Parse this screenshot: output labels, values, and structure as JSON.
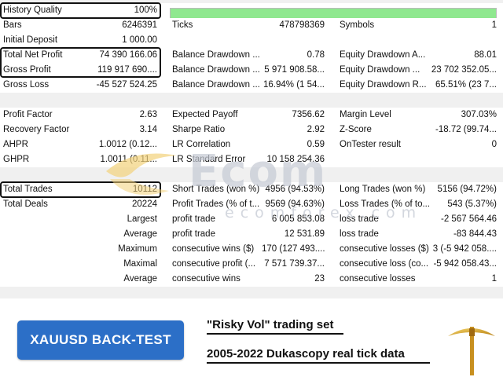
{
  "header": {
    "history_quality_label": "History Quality",
    "history_quality_value": "100%",
    "history_quality_fraction": 1.0
  },
  "rows": {
    "bars": {
      "l1": "Bars",
      "v1": "6246391",
      "l2": "Ticks",
      "v2": "478798369",
      "l3": "Symbols",
      "v3": "1"
    },
    "deposit": {
      "l1": "Initial Deposit",
      "v1": "1 000.00"
    },
    "net_profit": {
      "l1": "Total Net Profit",
      "v1": "74 390 166.06",
      "l2": "Balance Drawdown ...",
      "v2": "0.78",
      "l3": "Equity Drawdown A...",
      "v3": "88.01"
    },
    "gross_profit": {
      "l1": "Gross Profit",
      "v1": "119 917 690....",
      "l2": "Balance Drawdown ...",
      "v2": "5 971 908.58...",
      "l3": "Equity Drawdown ...",
      "v3": "23 702 352.05..."
    },
    "gross_loss": {
      "l1": "Gross Loss",
      "v1": "-45 527 524.25",
      "l2": "Balance Drawdown ...",
      "v2": "16.94% (1 54...",
      "l3": "Equity Drawdown R...",
      "v3": "65.51% (23 7..."
    },
    "profit_factor": {
      "l1": "Profit Factor",
      "v1": "2.63",
      "l2": "Expected Payoff",
      "v2": "7356.62",
      "l3": "Margin Level",
      "v3": "307.03%"
    },
    "recovery": {
      "l1": "Recovery Factor",
      "v1": "3.14",
      "l2": "Sharpe Ratio",
      "v2": "2.92",
      "l3": "Z-Score",
      "v3": "-18.72 (99.74..."
    },
    "ahpr": {
      "l1": "AHPR",
      "v1": "1.0012 (0.12...",
      "l2": "LR Correlation",
      "v2": "0.59",
      "l3": "OnTester result",
      "v3": "0"
    },
    "ghpr": {
      "l1": "GHPR",
      "v1": "1.0011 (0.11...",
      "l2": "LR Standard Error",
      "v2": "10 158 254.36"
    },
    "total_trades": {
      "l1": "Total Trades",
      "v1": "10112",
      "l2": "Short Trades (won %)",
      "v2": "4956 (94.53%)",
      "l3": "Long Trades (won %)",
      "v3": "5156 (94.72%)"
    },
    "total_deals": {
      "l1": "Total Deals",
      "v1": "20224",
      "l2": "Profit Trades (% of t...",
      "v2": "9569 (94.63%)",
      "l3": "Loss Trades (% of to...",
      "v3": "543 (5.37%)"
    },
    "largest": {
      "l1": "Largest",
      "l2": "profit trade",
      "v2": "6 005 853.08",
      "l3": "loss trade",
      "v3": "-2 567 564.46"
    },
    "average": {
      "l1": "Average",
      "l2": "profit trade",
      "v2": "12 531.89",
      "l3": "loss trade",
      "v3": "-83 844.43"
    },
    "maximum": {
      "l1": "Maximum",
      "l2": "consecutive wins ($)",
      "v2": "170 (127 493....",
      "l3": "consecutive losses ($)",
      "v3": "3 (-5 942 058...."
    },
    "maximal": {
      "l1": "Maximal",
      "l2": "consecutive profit (...",
      "v2": "7 571 739.37...",
      "l3": "consecutive loss (co...",
      "v3": "-5 942 058.43..."
    },
    "average2": {
      "l1": "Average",
      "l2": "consecutive wins",
      "v2": "23",
      "l3": "consecutive losses",
      "v3": "1"
    }
  },
  "watermark": {
    "logo": "Ecom",
    "domain": "ecomforex.com"
  },
  "footer": {
    "badge": "XAUUSD BACK-TEST",
    "line1": "\"Risky Vol\" trading set",
    "line2": "2005-2022 Dukascopy real tick data"
  },
  "colors": {
    "badge": "#2c6fc7",
    "progress": "#8fe88f",
    "gold": "#d4a020"
  }
}
